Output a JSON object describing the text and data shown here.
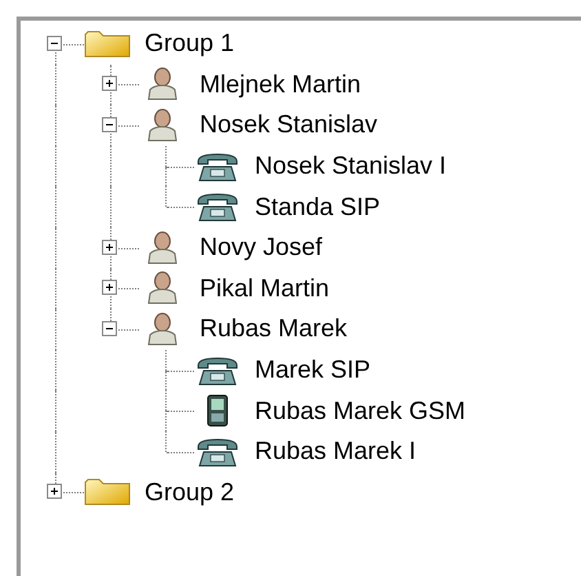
{
  "tree": [
    {
      "kind": "group",
      "label": "Group 1",
      "expanded": true,
      "children": [
        {
          "kind": "person",
          "label": "Mlejnek Martin",
          "expanded": false
        },
        {
          "kind": "person",
          "label": "Nosek Stanislav",
          "expanded": true,
          "children": [
            {
              "kind": "phone",
              "label": "Nosek Stanislav I"
            },
            {
              "kind": "phone",
              "label": "Standa SIP"
            }
          ]
        },
        {
          "kind": "person",
          "label": "Novy Josef",
          "expanded": false
        },
        {
          "kind": "person",
          "label": "Pikal Martin",
          "expanded": false
        },
        {
          "kind": "person",
          "label": "Rubas Marek",
          "expanded": true,
          "children": [
            {
              "kind": "phone",
              "label": "Marek SIP"
            },
            {
              "kind": "mobile",
              "label": "Rubas Marek GSM"
            },
            {
              "kind": "phone",
              "label": "Rubas Marek I"
            }
          ]
        }
      ]
    },
    {
      "kind": "group",
      "label": "Group 2",
      "expanded": false
    }
  ]
}
